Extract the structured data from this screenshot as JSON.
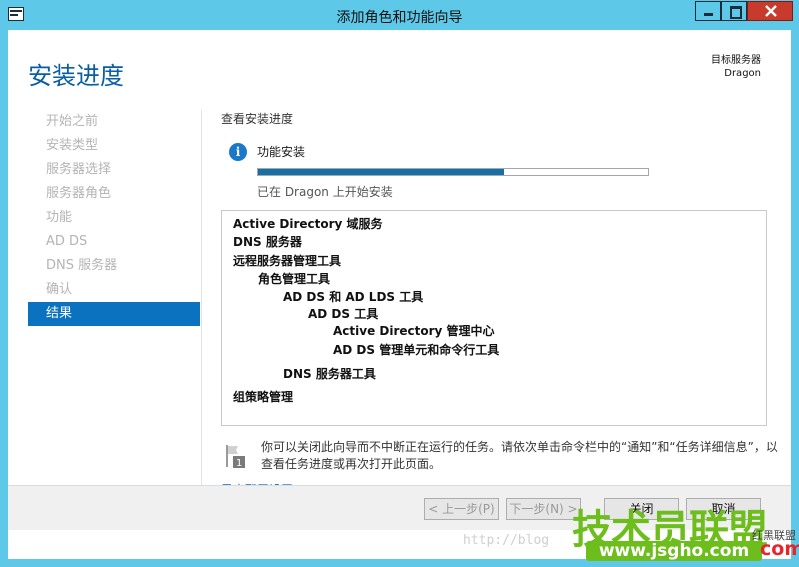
{
  "window": {
    "title": "添加角色和功能向导"
  },
  "header": {
    "heading": "安装进度",
    "target_label": "目标服务器",
    "target_name": "Dragon"
  },
  "nav": {
    "items": [
      {
        "label": "开始之前"
      },
      {
        "label": "安装类型"
      },
      {
        "label": "服务器选择"
      },
      {
        "label": "服务器角色"
      },
      {
        "label": "功能"
      },
      {
        "label": "AD DS"
      },
      {
        "label": "DNS 服务器"
      },
      {
        "label": "确认"
      },
      {
        "label": "结果"
      }
    ],
    "active_index": 8
  },
  "main": {
    "section_title": "查看安装进度",
    "feature_label": "功能安装",
    "progress_fraction": 0.63,
    "progress_status": "已在 Dragon 上开始安装",
    "results": [
      "Active Directory 域服务",
      "DNS 服务器",
      "远程服务器管理工具",
      "角色管理工具",
      "AD DS 和 AD LDS 工具",
      "AD DS 工具",
      "Active Directory 管理中心",
      "AD DS 管理单元和命令行工具",
      "DNS 服务器工具",
      "组策略管理"
    ],
    "note_badge": "1",
    "note": "你可以关闭此向导而不中断正在运行的任务。请依次单击命令栏中的“通知”和“任务详细信息”，以查看任务进度或再次打开此页面。",
    "export_link": "导出配置设置"
  },
  "footer": {
    "prev_label": "< 上一步(P)",
    "next_label": "下一步(N) >",
    "close_label": "关闭",
    "cancel_label": "取消"
  },
  "watermark": {
    "url": "http://blog",
    "logo": "技术员联盟",
    "site": "www.jsgho.com",
    "com": "com",
    "corner": "红黑联盟"
  },
  "colors": {
    "titlebar": "#5dc8e8",
    "accent": "#0a72bf",
    "close_button": "#c83a2c",
    "progress": "#166fa6"
  }
}
